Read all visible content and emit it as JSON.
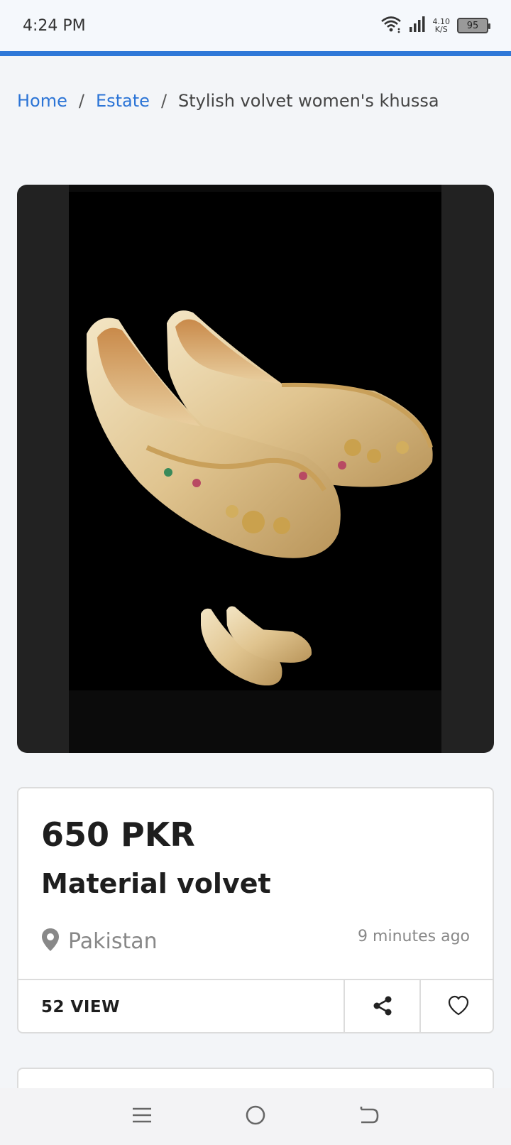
{
  "status_bar": {
    "time": "4:24 PM",
    "net_speed_value": "4.10",
    "net_speed_unit": "K/S",
    "battery": "95",
    "icons": [
      "wifi-icon",
      "signal-icon",
      "battery-icon"
    ]
  },
  "breadcrumb": {
    "items": [
      {
        "label": "Home"
      },
      {
        "label": "Estate"
      }
    ],
    "separator": "/",
    "current": "Stylish volvet women's khussa"
  },
  "gallery": {
    "image_alt": "gold embroidered khussa shoes",
    "thumbnail_count": 1
  },
  "listing": {
    "price": "650 PKR",
    "title": "Material volvet",
    "location": "Pakistan",
    "posted": "9 minutes ago",
    "views": "52 VIEW"
  },
  "actions": {
    "share_icon": "share-icon",
    "favorite_icon": "heart-icon"
  },
  "nav_bar": {
    "icons": [
      "menu-icon",
      "home-circle-icon",
      "back-icon"
    ]
  },
  "colors": {
    "accent": "#2f78d8",
    "link": "#2b74d6",
    "shoe_gold": "#e6d2a8"
  }
}
